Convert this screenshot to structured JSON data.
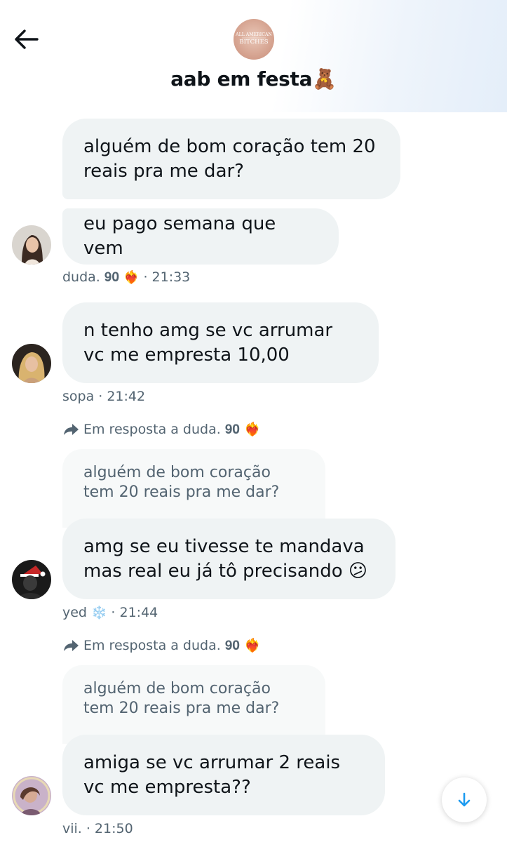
{
  "header": {
    "back_icon": "arrow-left-icon",
    "group_avatar_text": "ALL AMERICAN BITCHES",
    "title": "aab em festa",
    "title_emoji": "🧸"
  },
  "messages": [
    {
      "sender": "duda. 𝟗𝟎",
      "sender_emoji": "❤️‍🔥",
      "time": "· 21:33",
      "bubbles": [
        "alguém de bom coração tem 20 reais pra me dar?",
        "eu pago semana que vem"
      ]
    },
    {
      "sender": "sopa",
      "time": "· 21:42",
      "bubbles": [
        "n tenho amg se vc arrumar vc me empresta 10,00"
      ]
    },
    {
      "reply_to": "Em resposta a duda. 𝟗𝟎",
      "reply_emoji": "❤️‍🔥",
      "quoted_text": "alguém de bom coração tem 20 reais pra me dar?",
      "sender": "yed",
      "sender_emoji": "❄️",
      "time": "· 21:44",
      "bubbles": [
        "amg se eu tivesse te mandava mas real eu já tô precisando 😕"
      ]
    },
    {
      "reply_to": "Em resposta a duda. 𝟗𝟎",
      "reply_emoji": "❤️‍🔥",
      "quoted_text": "alguém de bom coração tem 20 reais pra me dar?",
      "sender": "vii.",
      "time": "· 21:50",
      "bubbles": [
        "amiga se vc arrumar 2 reais vc me empresta??"
      ]
    }
  ],
  "scroll_button": {
    "icon": "arrow-down-icon"
  },
  "colors": {
    "bubble_bg": "#eff3f4",
    "quote_bg": "#f7f9f9",
    "meta_text": "#536471",
    "text": "#0f1419",
    "accent": "#1d9bf0"
  }
}
